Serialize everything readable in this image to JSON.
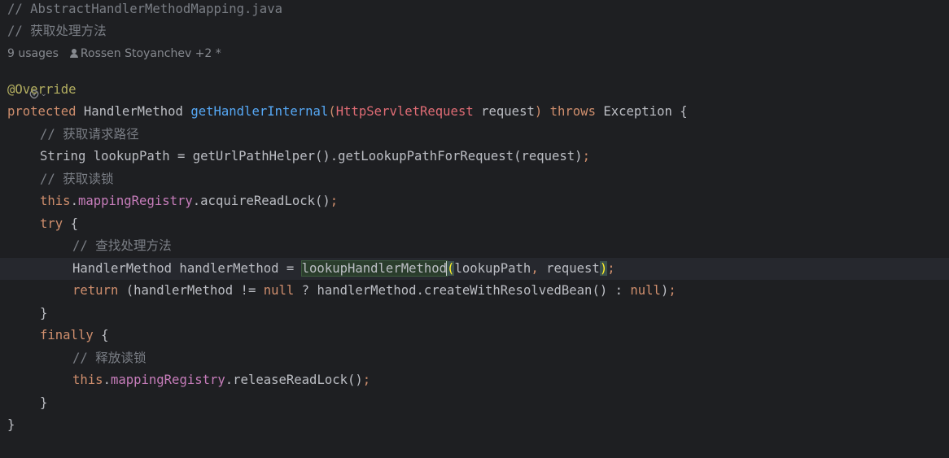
{
  "editor": {
    "header_comments": [
      "// AbstractHandlerMethodMapping.java",
      "// 获取处理方法"
    ],
    "inlay": {
      "usages": "9 usages",
      "authors": "Rossen Stoyanchev +2 *"
    },
    "code": {
      "annotation": "@Override",
      "sig_protected": "protected",
      "sig_type": "HandlerMethod",
      "sig_name": "getHandlerInternal",
      "sig_open": "(",
      "sig_param_type": "HttpServletRequest",
      "sig_param_name": " request",
      "sig_close": ")",
      "sig_throws": "throws",
      "sig_exc": "Exception",
      "sig_brace": "{",
      "c_path": "// 获取请求路径",
      "l_path_decl": "String lookupPath = getUrlPathHelper().getLookupPathForRequest(request)",
      "semi": ";",
      "c_lock": "// 获取读锁",
      "this_kw": "this",
      "dot": ".",
      "field_registry": "mappingRegistry",
      "acquire_call": ".acquireReadLock()",
      "try_kw": "try",
      "open_brace": "{",
      "c_find": "// 查找处理方法",
      "hm_decl": "HandlerMethod handlerMethod = ",
      "lookup_fn": "lookupHandlerMethod",
      "paren_open": "(",
      "arg_path": "lookupPath",
      "comma": ",",
      "arg_req": " request",
      "paren_close": ")",
      "return_kw": "return",
      "ret_open": " (handlerMethod != ",
      "null_kw": "null",
      "ret_mid": " ? handlerMethod.createWithResolvedBean() : ",
      "ret_close": ")",
      "close_brace": "}",
      "finally_kw": "finally",
      "c_release": "// 释放读锁",
      "release_call": ".releaseReadLock()"
    }
  },
  "colors": {
    "background": "#1e1f22",
    "keyword": "#cf8e6d",
    "comment": "#7a7e85",
    "annotation": "#b3ae60",
    "function": "#56a8f5",
    "field": "#c77dbb",
    "unresolved_type": "#e06c75",
    "text": "#bcbec4"
  },
  "icons": {
    "ai_assistant": "ai-icon",
    "chevron": "chevron-down-icon",
    "author": "person-icon"
  }
}
